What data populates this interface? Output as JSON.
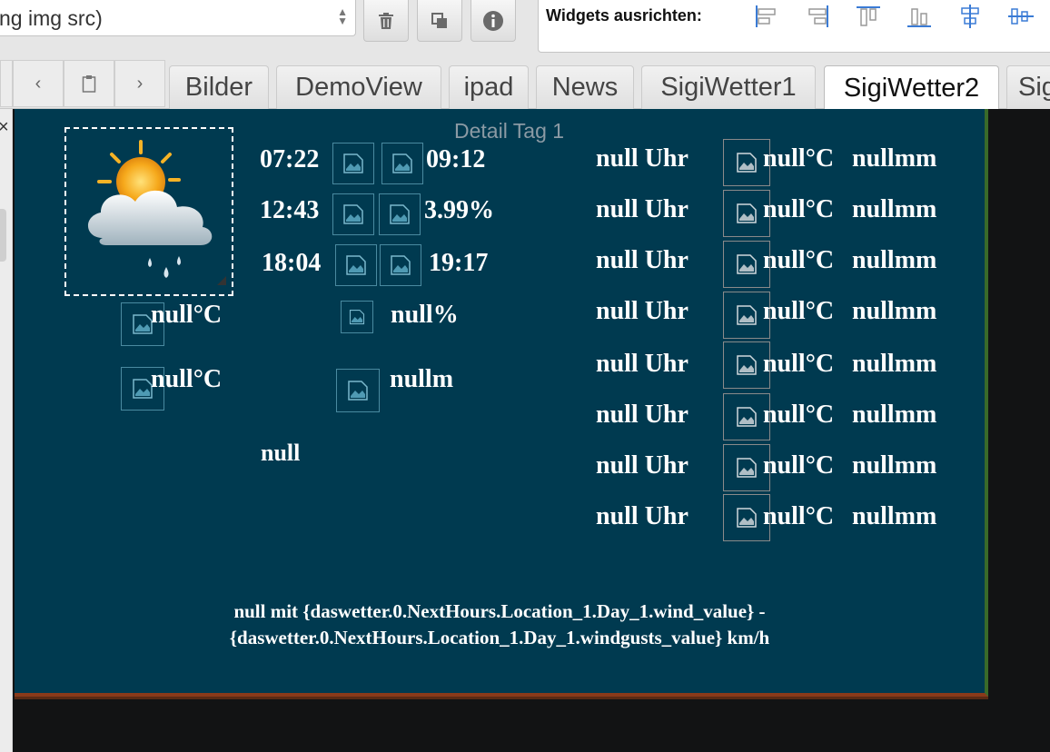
{
  "toolbar": {
    "select_value": "ng img src)",
    "buttons": [
      {
        "name": "delete",
        "icon": "trash-icon"
      },
      {
        "name": "copy",
        "icon": "copy-icon"
      },
      {
        "name": "info",
        "icon": "info-icon"
      }
    ],
    "align_label": "Widgets ausrichten:",
    "align_icons": [
      "align-left-icon",
      "align-right-icon",
      "align-top-icon",
      "align-bottom-icon",
      "align-center-vertical-icon",
      "align-center-horizontal-icon"
    ]
  },
  "tabs": {
    "items": [
      "Bilder",
      "DemoView",
      "ipad",
      "News",
      "SigiWetter1",
      "SigiWetter2",
      "Sig"
    ],
    "active": "SigiWetter2"
  },
  "view": {
    "title": "Detail Tag 1",
    "times": {
      "row1_left": "07:22",
      "row1_right": "09:12",
      "row2_left": "12:43",
      "row2_right": "3.99%",
      "row3_left": "18:04",
      "row3_right": "19:17"
    },
    "temp_max": "null°C",
    "temp_min": "null°C",
    "rain_percent": "null%",
    "rain_mm": "nullm",
    "text_value": "null",
    "hours": [
      {
        "time": "null Uhr",
        "temp": "null°C",
        "rain": "nullmm"
      },
      {
        "time": "null Uhr",
        "temp": "null°C",
        "rain": "nullmm"
      },
      {
        "time": "null Uhr",
        "temp": "null°C",
        "rain": "nullmm"
      },
      {
        "time": "null Uhr",
        "temp": "null°C",
        "rain": "nullmm"
      },
      {
        "time": "null Uhr",
        "temp": "null°C",
        "rain": "nullmm"
      },
      {
        "time": "null Uhr",
        "temp": "null°C",
        "rain": "nullmm"
      },
      {
        "time": "null Uhr",
        "temp": "null°C",
        "rain": "nullmm"
      },
      {
        "time": "null Uhr",
        "temp": "null°C",
        "rain": "nullmm"
      }
    ],
    "wind_line1": "null mit {daswetter.0.NextHours.Location_1.Day_1.wind_value} -",
    "wind_line2": "{daswetter.0.NextHours.Location_1.Day_1.windgusts_value} km/h"
  },
  "colors": {
    "view_background": "#003a50",
    "editor_background": "#121314",
    "toolbar_background": "#e6e6e6",
    "align_icon_blue": "#3a7bd5"
  }
}
